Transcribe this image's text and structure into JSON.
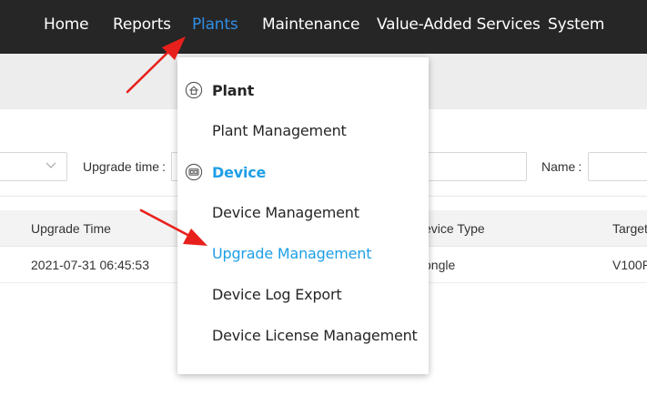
{
  "nav": {
    "items": [
      {
        "label": "Home"
      },
      {
        "label": "Reports"
      },
      {
        "label": "Plants"
      },
      {
        "label": "Maintenance"
      },
      {
        "label": "Value-Added Services"
      },
      {
        "label": "System"
      }
    ],
    "active": "Plants"
  },
  "filters": {
    "upgrade_time_label": "Upgrade time",
    "name_label": "Name"
  },
  "table": {
    "columns": [
      "Upgrade Time",
      "evice Type",
      "Target"
    ],
    "rows": [
      {
        "upgrade_time": "2021-07-31 06:45:53",
        "device_type": "ongle",
        "target": "V100R"
      }
    ]
  },
  "dropdown": {
    "plant_group": {
      "title": "Plant",
      "icon": "plant-icon",
      "items": [
        "Plant Management"
      ]
    },
    "device_group": {
      "title": "Device",
      "icon": "device-icon",
      "items": [
        "Device Management",
        "Upgrade Management",
        "Device Log Export",
        "Device License Management"
      ]
    },
    "active_item": "Upgrade Management"
  },
  "colors": {
    "nav_bg": "#262626",
    "nav_active": "#2f8fe6",
    "menu_active": "#1e9fe6",
    "annotation_arrow": "#e8201b"
  }
}
